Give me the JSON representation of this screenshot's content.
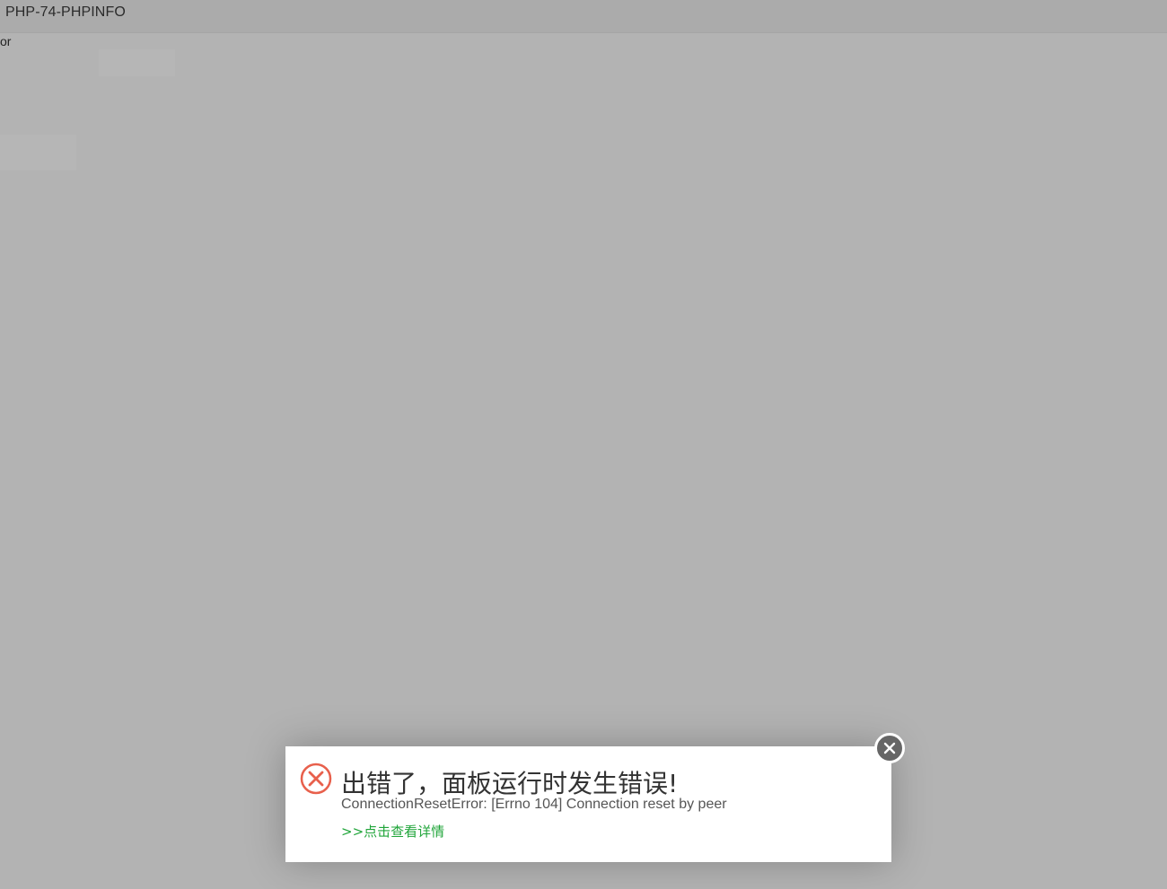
{
  "window": {
    "title": "PHP-74-PHPINFO",
    "subtitle_fragment": "or"
  },
  "dialog": {
    "title": "出错了，面板运行时发生错误!",
    "message": "ConnectionResetError: [Errno 104] Connection reset by peer",
    "details_link": ">>点击查看详情",
    "icon": "error-circle-x-icon",
    "close_icon": "close-icon"
  },
  "colors": {
    "overlay": "#b3b3b3",
    "error_red": "#e8604c",
    "link_green": "#20a53a",
    "close_bg": "#666666"
  }
}
